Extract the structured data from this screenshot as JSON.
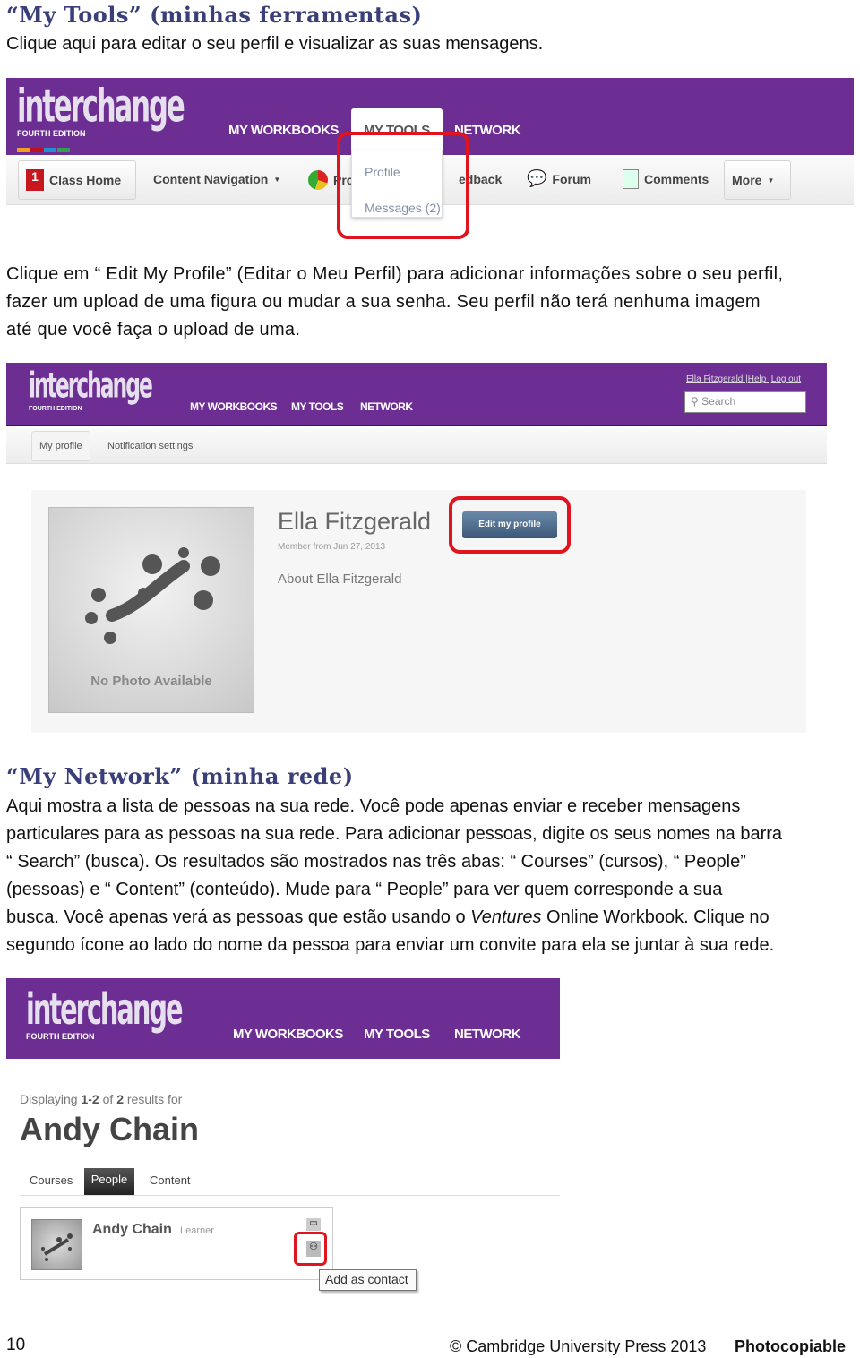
{
  "section1": {
    "heading": "“My Tools” (minhas ferramentas)",
    "text": "Clique aqui para editar o seu perfil e visualizar as suas mensagens."
  },
  "shot1": {
    "logo": "interchange",
    "edition": "FOURTH EDITION",
    "nav": [
      "MY WORKBOOKS",
      "MY TOOLS",
      "NETWORK"
    ],
    "toolbar": [
      "Class Home",
      "Content Navigation",
      "Pro",
      "edback",
      "Forum",
      "Comments",
      "More"
    ],
    "dropdown": [
      "Profile",
      "Messages (2)"
    ]
  },
  "para2": [
    "Clique em “ Edit My Profile” (Editar o Meu Perfil) para adicionar informações sobre o seu perfil,",
    "fazer um upload de uma figura ou mudar a sua senha. Seu perfil não terá nenhuma imagem",
    "até que você faça o upload de uma."
  ],
  "shot2": {
    "logo": "interchange",
    "edition": "FOURTH EDITION",
    "nav": [
      "MY WORKBOOKS",
      "MY TOOLS",
      "NETWORK"
    ],
    "user_links": [
      "Ella Fitzgerald",
      "Help",
      "Log out"
    ],
    "search_placeholder": "Search",
    "subnav": [
      "My profile",
      "Notification settings"
    ],
    "profile": {
      "name": "Ella Fitzgerald",
      "member_since": "Member from Jun 27, 2013",
      "about": "About Ella Fitzgerald",
      "edit_button": "Edit my profile",
      "no_photo": "No Photo Available"
    }
  },
  "section2": {
    "heading": "“My Network” (minha rede)",
    "lines": [
      "Aqui mostra a lista de pessoas na sua rede. Você pode apenas enviar e receber mensagens",
      "particulares para as pessoas na sua rede. Para adicionar pessoas, digite os seus nomes na barra",
      "“ Search” (busca). Os resultados são mostrados nas três abas: “ Courses” (cursos), “ People”",
      "(pessoas) e “ Content” (conteúdo). Mude para “ People” para ver quem corresponde a sua"
    ],
    "line5a": "busca. Você apenas verá as pessoas que estão usando o ",
    "line5i": "Ventures",
    "line5b": " Online Workbook. Clique no",
    "line6": "segundo ícone ao lado do nome da pessoa para enviar um convite para ela se juntar à sua rede."
  },
  "shot3": {
    "logo": "interchange",
    "edition": "FOURTH EDITION",
    "nav": [
      "MY WORKBOOKS",
      "MY TOOLS",
      "NETWORK"
    ],
    "results_pre": "Displaying ",
    "results_range": "1-2",
    "results_of": " of ",
    "results_total": "2",
    "results_post": " results for",
    "query": "Andy Chain",
    "tabs": [
      "Courses",
      "People",
      "Content"
    ],
    "active_tab": "People",
    "person_name": "Andy Chain",
    "person_role": "Learner",
    "tooltip": "Add as contact"
  },
  "footer": {
    "page": "10",
    "copyright": "© Cambridge University Press 2013",
    "photocopiable": "Photocopiable"
  },
  "colors": {
    "brand_purple": "#6c2e93",
    "highlight_red": "#e0141e",
    "heading": "#3a3f7a"
  }
}
